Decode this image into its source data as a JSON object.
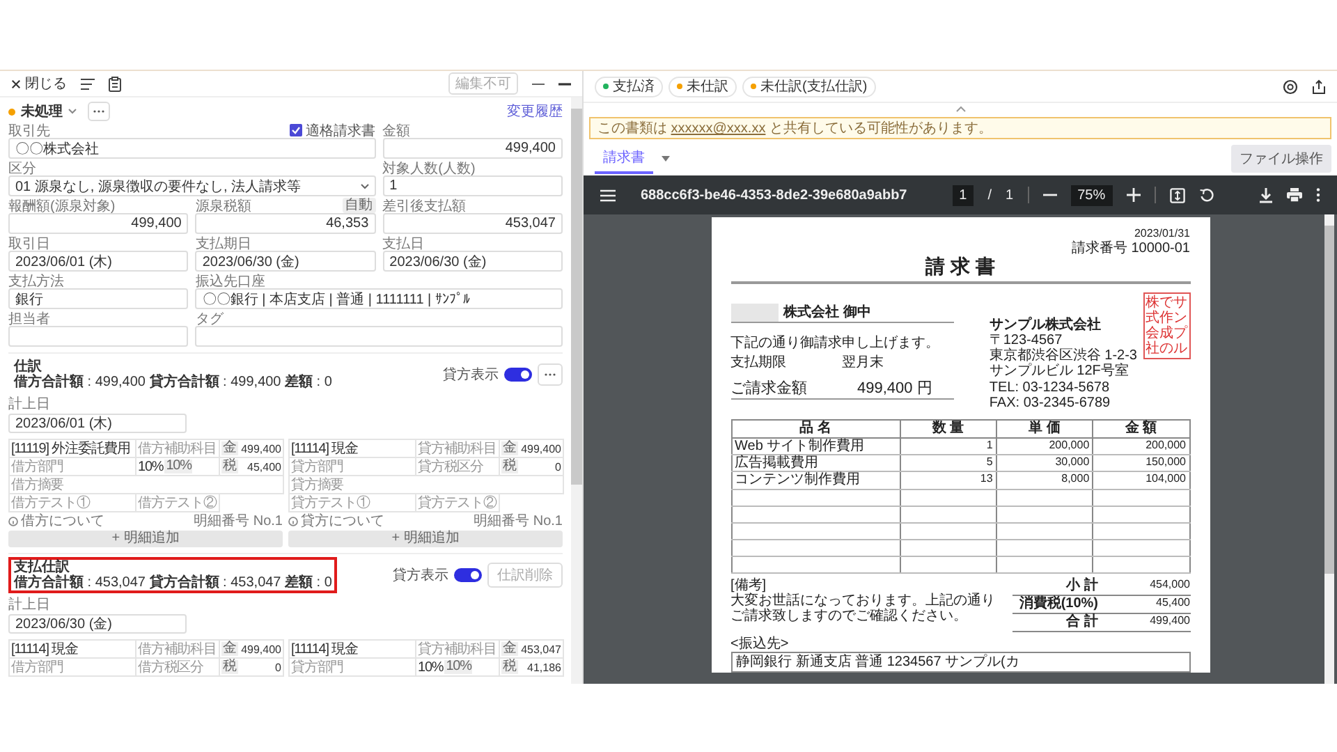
{
  "topbar": {
    "close_label": "閉じる",
    "edit_button": {
      "label": "編集不可",
      "disabled": true
    }
  },
  "status": {
    "label": "未処理"
  },
  "history_link": "変更履歴",
  "form_rows": [
    [
      {
        "label": "取引先",
        "kind": "text",
        "value": "〇〇株式会社",
        "checkbox": {
          "label": "適格請求書",
          "checked": true
        }
      },
      {
        "label": "金額",
        "kind": "amount",
        "value": "499,400"
      }
    ],
    [
      {
        "label": "区分",
        "kind": "select",
        "value": "01 源泉なし, 源泉徴収の要件なし, 法人請求等"
      },
      {
        "label": "対象人数(人数)",
        "kind": "text",
        "value": "1"
      }
    ],
    [
      {
        "label": "報酬額(源泉対象)",
        "kind": "amount",
        "value": "499,400"
      },
      {
        "label": "源泉税額",
        "kind": "amount",
        "value": "46,353",
        "badge": "自動"
      },
      {
        "label": "差引後支払額",
        "kind": "amount",
        "value": "453,047"
      }
    ],
    [
      {
        "label": "取引日",
        "kind": "text",
        "value": "2023/06/01 (木)"
      },
      {
        "label": "支払期日",
        "kind": "text",
        "value": "2023/06/30 (金)"
      },
      {
        "label": "支払日",
        "kind": "text",
        "value": "2023/06/30 (金)"
      }
    ],
    [
      {
        "label": "支払方法",
        "kind": "text",
        "value": "銀行"
      },
      {
        "label": "振込先口座",
        "kind": "text",
        "value": "〇〇銀行 | 本店支店 | 普通 | 1111111 | ｻﾝﾌﾟﾙ"
      }
    ],
    [
      {
        "label": "担当者",
        "kind": "text"
      },
      {
        "label": "タグ",
        "kind": "text"
      }
    ]
  ],
  "journals": [
    {
      "title": "仕訳",
      "totals": "**借方合計額** : 499,400 **貸方合計額** : 499,400 **差額** : 0",
      "highlighted": false,
      "toggle": {
        "label": "貸方表示",
        "on": true
      },
      "action": {
        "kind": "more"
      },
      "date_label": "計上日",
      "date": "2023/06/01 (木)",
      "sides": [
        {
          "rows": [
            [
              {
                "value": "[11119] 外注委託費用"
              },
              {
                "placeholder": "借方補助科目"
              },
              {
                "badge": "金",
                "value": "499,400"
              }
            ],
            [
              {
                "placeholder": "借方部門"
              },
              {
                "value": "10%",
                "badge": "10%"
              },
              {
                "badge": "税",
                "value": "45,400"
              }
            ],
            [
              {
                "placeholder": "借方摘要"
              }
            ],
            [
              {
                "placeholder": "借方テスト①"
              },
              {
                "placeholder": "借方テスト②"
              }
            ]
          ],
          "note": "借方について",
          "line_no": "明細番号 No.1",
          "add_button": "+ 明細追加"
        },
        {
          "rows": [
            [
              {
                "value": "[11114] 現金"
              },
              {
                "placeholder": "貸方補助科目"
              },
              {
                "badge": "金",
                "value": "499,400"
              }
            ],
            [
              {
                "placeholder": "貸方部門"
              },
              {
                "placeholder": "貸方税区分"
              },
              {
                "badge": "税",
                "value": "0"
              }
            ],
            [
              {
                "placeholder": "貸方摘要"
              }
            ],
            [
              {
                "placeholder": "貸方テスト①"
              },
              {
                "placeholder": "貸方テスト②"
              }
            ]
          ],
          "note": "貸方について",
          "line_no": "明細番号 No.1",
          "add_button": "+ 明細追加"
        }
      ]
    },
    {
      "title": "支払仕訳",
      "totals": "**借方合計額** : 453,047 **貸方合計額** : 453,047 **差額** : 0",
      "highlighted": true,
      "toggle": {
        "label": "貸方表示",
        "on": true
      },
      "action": {
        "kind": "button",
        "label": "仕訳削除",
        "disabled": true
      },
      "date_label": "計上日",
      "date": "2023/06/30 (金)",
      "sides": [
        {
          "rows": [
            [
              {
                "value": "[11114] 現金"
              },
              {
                "placeholder": "借方補助科目"
              },
              {
                "badge": "金",
                "value": "499,400"
              }
            ],
            [
              {
                "placeholder": "借方部門"
              },
              {
                "placeholder": "借方税区分"
              },
              {
                "badge": "税",
                "value": "0"
              }
            ]
          ]
        },
        {
          "rows": [
            [
              {
                "value": "[11114] 現金"
              },
              {
                "placeholder": "貸方補助科目"
              },
              {
                "badge": "金",
                "value": "453,047"
              }
            ],
            [
              {
                "placeholder": "貸方部門"
              },
              {
                "value": "10%",
                "badge": "10%"
              },
              {
                "badge": "税",
                "value": "41,186"
              }
            ]
          ]
        }
      ]
    }
  ],
  "chips": [
    {
      "label": "支払済",
      "color": "#22b35e"
    },
    {
      "label": "未仕訳",
      "color": "#f5a000"
    },
    {
      "label": "未仕訳(支払仕訳)",
      "color": "#f5a000"
    }
  ],
  "banner": {
    "before": "この書類は ",
    "link": "xxxxxx@xxx.xx",
    "after": " と共有している可能性があります。"
  },
  "doc_tabs": [
    {
      "label": "請求書",
      "selected": true
    }
  ],
  "file_button": "ファイル操作",
  "viewer": {
    "filename": "688cc6f3-be46-4353-8de2-39e680a9abb7",
    "page": "1",
    "page_sep": "/",
    "page_total": "1",
    "zoom": "75%"
  },
  "document": {
    "date": "2023/01/31",
    "number": "請求番号 10000-01",
    "title": "請 求 書",
    "recipient": "株式会社 御中",
    "message": "下記の通り御請求申し上げます。",
    "due_label": "支払期限",
    "due_value": "翌月末",
    "stamp": [
      "株式会社",
      "で作成の",
      "サンプル"
    ],
    "issuer": "サンプル株式会社",
    "issuer_lines": [
      "〒123-4567",
      "東京都渋谷区渋谷 1-2-3",
      "サンプルビル 12F号室",
      "TEL: 03-1234-5678",
      "FAX: 03-2345-6789"
    ],
    "amount_label": "ご請求金額",
    "amount": "499,400 円",
    "columns": [
      "品 名",
      "数 量",
      "単 価",
      "金 額"
    ],
    "rows": [
      [
        "Web サイト制作費用",
        "1",
        "200,000",
        "200,000"
      ],
      [
        "広告掲載費用",
        "5",
        "30,000",
        "150,000"
      ],
      [
        "コンテンツ制作費用",
        "13",
        "8,000",
        "104,000"
      ]
    ],
    "note_title": "[備考]",
    "note": "大変お世話になっております。上記の通りご請求致しますのでご確認ください。",
    "totals": [
      {
        "label": "小 計",
        "value": "454,000"
      },
      {
        "label": "消費税(10%)",
        "value": "45,400"
      },
      {
        "label": "合 計",
        "value": "499,400"
      }
    ],
    "bank_title": "<振込先>",
    "bank": "静岡銀行 新通支店 普通 1234567 サンプル(カ"
  }
}
